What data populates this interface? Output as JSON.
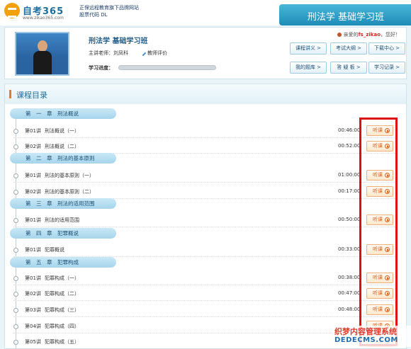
{
  "header": {
    "logo_text": "自考365",
    "logo_url": "www.zikao365.com",
    "tagline_line1": "正保远程教育旗下品牌网站",
    "tagline_line2": "股票代码  DL",
    "banner_title": "刑法学 基础学习班"
  },
  "course": {
    "title": "刑法学 基础学习班",
    "teacher": "主讲老师：刘凤科",
    "evaluate": "教师评价",
    "progress_label": "学习进度：",
    "progress_percent": 0,
    "greeting_prefix": "亲爱的",
    "username": "fs_zikao",
    "greeting_suffix": "，您好！",
    "buttons": [
      {
        "label": "课程讲义 >"
      },
      {
        "label": "考试大纲 >"
      },
      {
        "label": "下载中心 >"
      },
      {
        "label": "我的题库 >"
      },
      {
        "label": "答  疑  板 >"
      },
      {
        "label": "学习记录 >"
      }
    ]
  },
  "catalog": {
    "title": "课程目录",
    "listen_label": "听课",
    "chapters": [
      {
        "label": "第　一　章　刑法概说",
        "lessons": [
          {
            "num": "第01讲",
            "name": "刑法概说（一）",
            "duration": "00:46:00"
          },
          {
            "num": "第02讲",
            "name": "刑法概说（二）",
            "duration": "00:52:00"
          }
        ]
      },
      {
        "label": "第　二　章　刑法的基本原则",
        "lessons": [
          {
            "num": "第01讲",
            "name": "刑法的基本原则（一）",
            "duration": "01:00:00"
          },
          {
            "num": "第02讲",
            "name": "刑法的基本原则（二）",
            "duration": "00:17:00"
          }
        ]
      },
      {
        "label": "第　三　章　刑法的适用范围",
        "lessons": [
          {
            "num": "第01讲",
            "name": "刑法的适用范围",
            "duration": "00:50:00"
          }
        ]
      },
      {
        "label": "第　四　章　犯罪概说",
        "lessons": [
          {
            "num": "第01讲",
            "name": "犯罪概说",
            "duration": "00:33:00"
          }
        ]
      },
      {
        "label": "第　五　章　犯罪构成",
        "lessons": [
          {
            "num": "第01讲",
            "name": "犯罪构成（一）",
            "duration": "00:38:00"
          },
          {
            "num": "第02讲",
            "name": "犯罪构成（二）",
            "duration": "00:47:00"
          },
          {
            "num": "第03讲",
            "name": "犯罪构成（三）",
            "duration": "00:48:00"
          },
          {
            "num": "第04讲",
            "name": "犯罪构成（四）",
            "duration": ""
          },
          {
            "num": "第05讲",
            "name": "犯罪构成（五）",
            "duration": ""
          }
        ]
      }
    ]
  },
  "watermark": {
    "line1": "织梦内容管理系统",
    "line2": "DEDECMS.COM"
  }
}
